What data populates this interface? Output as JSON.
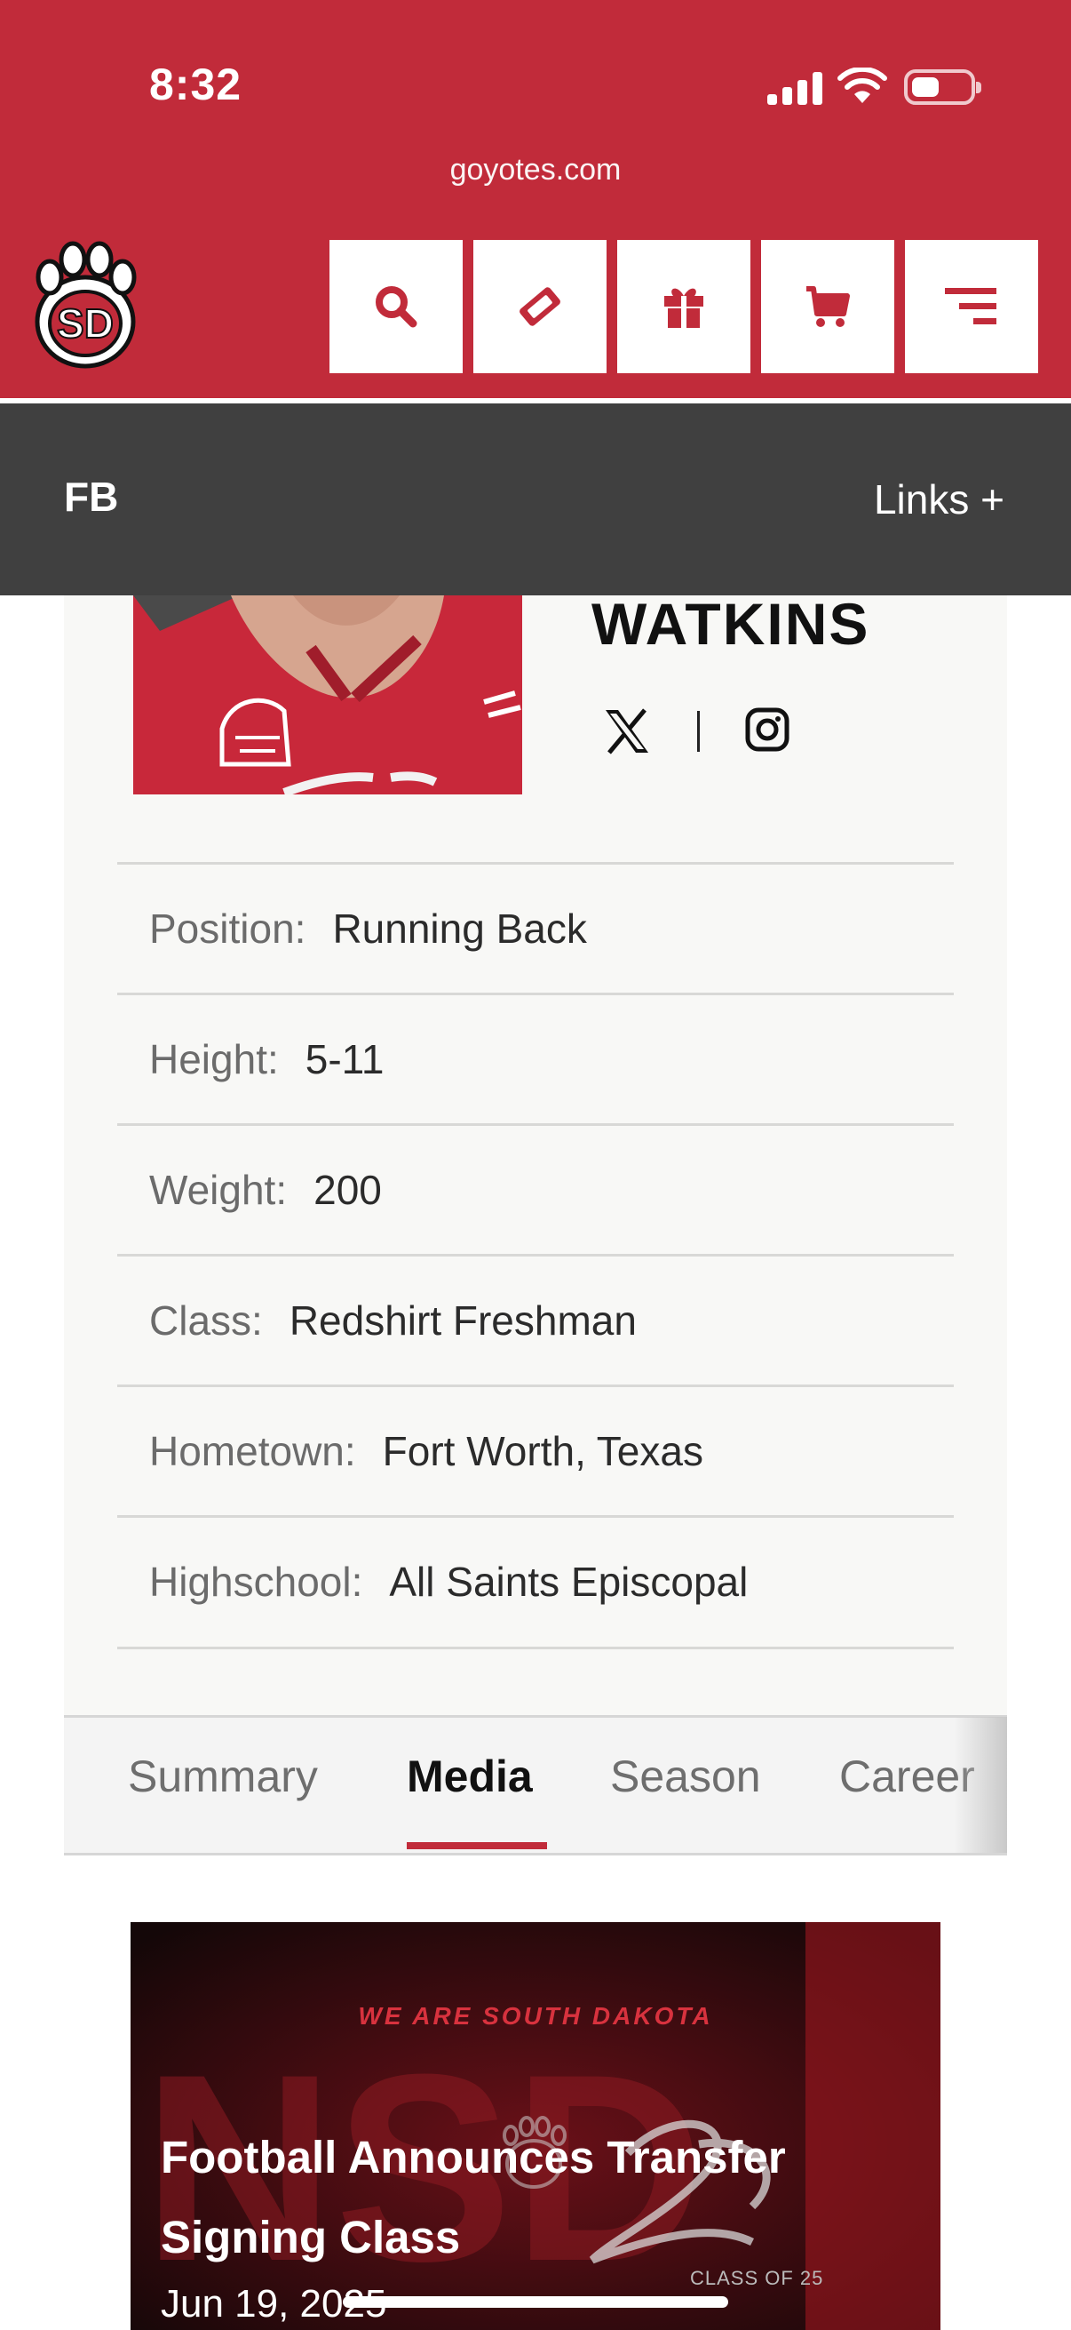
{
  "status_bar": {
    "time": "8:32",
    "url": "goyotes.com"
  },
  "header": {
    "logo_alt": "SD",
    "nav_buttons": [
      {
        "name": "search-button",
        "icon": "search-icon"
      },
      {
        "name": "tickets-button",
        "icon": "ticket-icon"
      },
      {
        "name": "give-button",
        "icon": "gift-icon"
      },
      {
        "name": "shop-button",
        "icon": "cart-icon"
      },
      {
        "name": "menu-button",
        "icon": "menu-icon"
      }
    ],
    "accent": "#c12b3a"
  },
  "sport_bar": {
    "sport": "FB",
    "links": "Links +"
  },
  "player": {
    "last_name": "WATKINS",
    "details": [
      {
        "label": "Position:",
        "value": "Running Back"
      },
      {
        "label": "Height:",
        "value": "5-11"
      },
      {
        "label": "Weight:",
        "value": "200"
      },
      {
        "label": "Class:",
        "value": "Redshirt Freshman"
      },
      {
        "label": "Hometown:",
        "value": "Fort Worth, Texas"
      },
      {
        "label": "Highschool:",
        "value": "All Saints Episcopal"
      }
    ]
  },
  "tabs": [
    {
      "label": "Summary",
      "active": false
    },
    {
      "label": "Media",
      "active": true
    },
    {
      "label": "Season",
      "active": false
    },
    {
      "label": "Career",
      "active": false
    }
  ],
  "media": {
    "kicker": "WE ARE SOUTH DAKOTA",
    "title": "Football Announces Transfer Signing Class",
    "date": "Jun 19, 2025",
    "graphic_text": "CLASS OF 25"
  }
}
